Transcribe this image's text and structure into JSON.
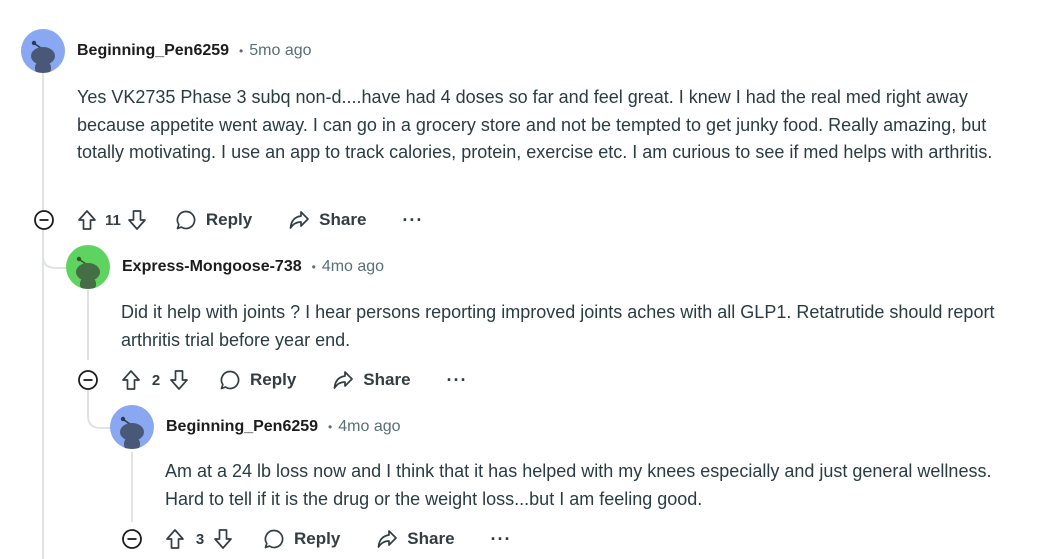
{
  "comments": [
    {
      "username": "Beginning_Pen6259",
      "separator": "•",
      "time": "5mo ago",
      "text": "Yes VK2735 Phase 3 subq non-d....have had 4 doses so far and feel great. I knew I had the real med right away because appetite went away. I can go in a grocery store and not be tempted to get junky food. Really amazing, but totally motivating. I use an app to track calories, protein, exercise etc. I am curious to see if med helps with arthritis.",
      "votes": "11",
      "reply_label": "Reply",
      "share_label": "Share",
      "more_label": "···",
      "avatar_color": "#8aa8f2"
    },
    {
      "username": "Express-Mongoose-738",
      "separator": "•",
      "time": "4mo ago",
      "text": "Did it help with joints ? I hear persons reporting improved joints aches with all GLP1. Retatrutide should report arthritis trial before year end.",
      "votes": "2",
      "reply_label": "Reply",
      "share_label": "Share",
      "more_label": "···",
      "avatar_color": "#5fd35f"
    },
    {
      "username": "Beginning_Pen6259",
      "separator": "•",
      "time": "4mo ago",
      "text": "Am at a 24 lb loss now and I think that it has helped with my knees especially and just general wellness. Hard to tell if it is the drug or the weight loss...but I am feeling good.",
      "votes": "3",
      "reply_label": "Reply",
      "share_label": "Share",
      "more_label": "···",
      "avatar_color": "#8aa8f2"
    }
  ],
  "colors": {
    "text": "#2a3c42",
    "meta": "#576f76",
    "thread_line": "#dfe3e6",
    "icon": "#333d42"
  }
}
